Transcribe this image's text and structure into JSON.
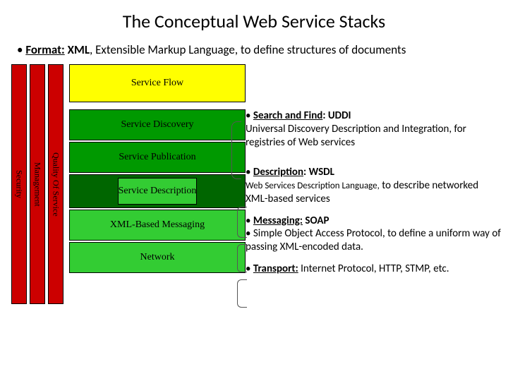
{
  "title": "The Conceptual Web Service Stacks",
  "format": {
    "label": "Format:",
    "value": "XML",
    "rest": ", Extensible Markup Language, to define structures of documents"
  },
  "vbars": {
    "security": "Security",
    "management": "Management",
    "qos": "Quality Of Service"
  },
  "layers": {
    "flow": "Service Flow",
    "disc": "Service Discovery",
    "pub": "Service Publication",
    "desc": "Service Description",
    "xmlmsg": "XML-Based Messaging",
    "net": "Network"
  },
  "annots": {
    "search": {
      "label": "Search and Find",
      "value": ":  UDDI",
      "body": "Universal Discovery Description and Integration, for registries of Web services"
    },
    "desc": {
      "label": "Description",
      "value": ": WSDL",
      "body1": "Web Services Description Language,",
      "body2": " to describe networked XML-based services"
    },
    "msg": {
      "label": "Messaging:",
      "value": " SOAP",
      "body": "Simple Object Access Protocol, to define a uniform way of passing XML-encoded data."
    },
    "trans": {
      "label": "Transport:",
      "value": " Internet Protocol, HTTP, STMP, etc."
    }
  }
}
